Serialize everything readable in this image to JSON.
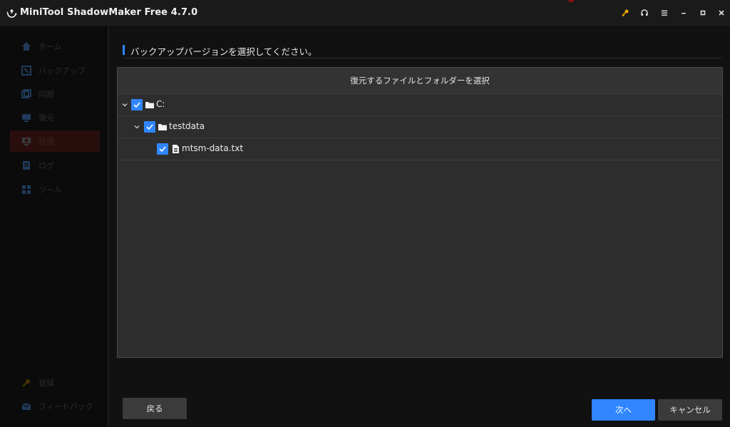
{
  "window": {
    "title": "MiniTool ShadowMaker Free 4.7.0",
    "controls": [
      "key-icon",
      "headset-icon",
      "menu-icon",
      "minimize-icon",
      "maximize-icon",
      "close-icon"
    ]
  },
  "sidebar": {
    "items": [
      {
        "label": "ホーム",
        "icon": "home-icon"
      },
      {
        "label": "バックアップ",
        "icon": "backup-icon"
      },
      {
        "label": "同期",
        "icon": "sync-icon"
      },
      {
        "label": "復元",
        "icon": "restore-icon"
      },
      {
        "label": "管理",
        "icon": "manage-icon",
        "active": true
      },
      {
        "label": "ログ",
        "icon": "log-icon"
      },
      {
        "label": "ツール",
        "icon": "tools-icon"
      }
    ],
    "bottom": [
      {
        "label": "登録",
        "icon": "key-icon"
      },
      {
        "label": "フィードバック",
        "icon": "mail-icon"
      }
    ]
  },
  "main": {
    "page_title": "バックアップバージョンを選択してください。",
    "panel_title": "復元するファイルとフォルダーを選択",
    "tree": [
      {
        "label": "C:",
        "level": 0,
        "expanded": true,
        "checked": true,
        "icon": "folder-icon"
      },
      {
        "label": "testdata",
        "level": 1,
        "expanded": true,
        "checked": true,
        "icon": "folder-icon"
      },
      {
        "label": "mtsm-data.txt",
        "level": 2,
        "checked": true,
        "icon": "file-icon"
      }
    ]
  },
  "footer": {
    "back_label": "戻る",
    "next_label": "次へ",
    "cancel_label": "キャンセル"
  },
  "colors": {
    "accent": "#2f86ff",
    "key": "#f0a400",
    "background": "#111111"
  }
}
